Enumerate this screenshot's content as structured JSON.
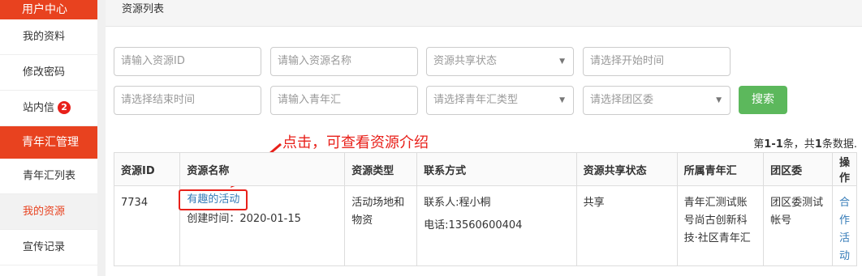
{
  "sidebar": {
    "section1": "用户中心",
    "items1": [
      {
        "label": "我的资料"
      },
      {
        "label": "修改密码"
      },
      {
        "label": "站内信",
        "badge": "2"
      }
    ],
    "section2": "青年汇管理",
    "items2": [
      {
        "label": "青年汇列表"
      },
      {
        "label": "我的资源"
      },
      {
        "label": "宣传记录"
      }
    ]
  },
  "breadcrumb": "资源列表",
  "filters": {
    "resource_id": "请输入资源ID",
    "resource_name": "请输入资源名称",
    "share_status": "资源共享状态",
    "start_time": "请选择开始时间",
    "end_time": "请选择结束时间",
    "youth_club": "请输入青年汇",
    "youth_club_type": "请选择青年汇类型",
    "league_committee": "请选择团区委",
    "search": "搜索"
  },
  "annotation": "点击，可查看资源介绍",
  "summary": {
    "prefix": "第",
    "range": "1-1",
    "mid": "条，共",
    "total": "1",
    "suffix": "条数据."
  },
  "table": {
    "headers": [
      "资源ID",
      "资源名称",
      "资源类型",
      "联系方式",
      "资源共享状态",
      "所属青年汇",
      "团区委",
      "操作"
    ],
    "rows": [
      {
        "id": "7734",
        "name": "有趣的活动",
        "created": "创建时间：2020-01-15",
        "type": "活动场地和物资",
        "contact_person": "联系人:程小桐",
        "phone": "电话:13560600404",
        "share": "共享",
        "club": "青年汇测试账号尚古创新科技·社区青年汇",
        "committee": "团区委测试帐号",
        "action": "合作活动"
      }
    ]
  },
  "colors": {
    "accent": "#e8421f",
    "link": "#337ab7",
    "success": "#5cb85c",
    "annotation": "#e8201a"
  }
}
